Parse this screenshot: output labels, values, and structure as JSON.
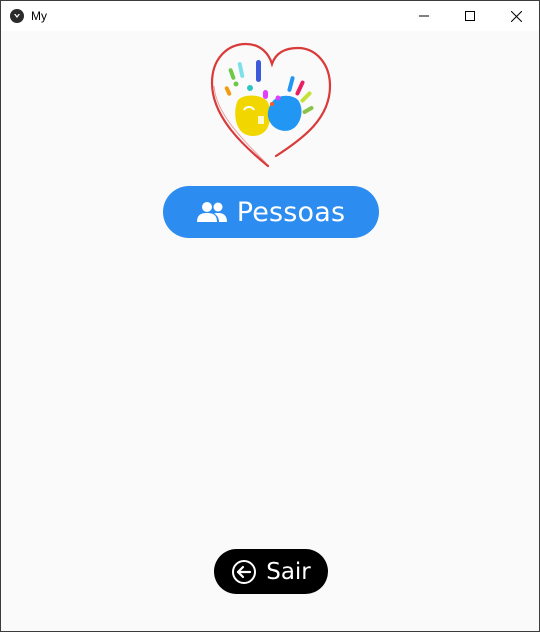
{
  "window": {
    "title": "My",
    "app_icon": "kivy-icon",
    "controls": {
      "minimize": "minimize-icon",
      "maximize": "maximize-icon",
      "close": "close-icon"
    }
  },
  "main": {
    "logo": "heart-handprints-logo",
    "pessoas_button": {
      "label": "Pessoas",
      "icon": "people-icon",
      "color": "#2d8cf0"
    },
    "sair_button": {
      "label": "Sair",
      "icon": "arrow-left-circle-icon",
      "color": "#000000"
    }
  }
}
